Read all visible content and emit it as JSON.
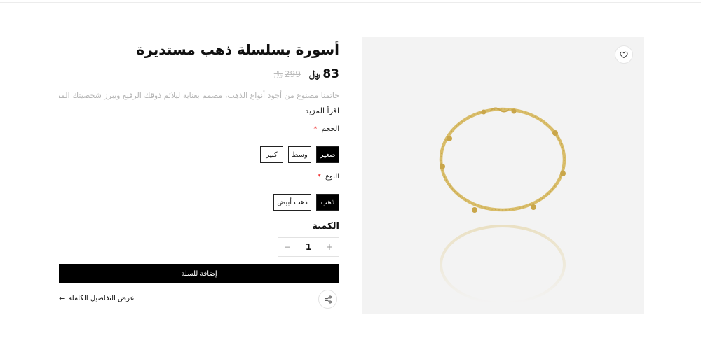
{
  "product": {
    "title": "أسورة بسلسلة ذهب مستديرة",
    "price": "83",
    "old_price": "299",
    "currency_symbol": "﷼",
    "description": "خاتمنا مصنوع من أجود أنواع الذهب، مصمم بعناية ليلائم ذوقك الرفيع ويبرز شخصيتك المميزة...",
    "read_more": "اقرأ المزيد"
  },
  "options": {
    "size": {
      "label": "الحجم",
      "required_mark": "*",
      "values": [
        "صغير",
        "وسط",
        "كبير"
      ],
      "selected": "صغير"
    },
    "type": {
      "label": "النوع",
      "required_mark": "*",
      "values": [
        "ذهب",
        "ذهب أبيض"
      ],
      "selected": "ذهب"
    }
  },
  "quantity": {
    "label": "الكمية",
    "value": "1",
    "increment": "+",
    "decrement": "−"
  },
  "actions": {
    "add_to_cart": "إضافة للسلة",
    "full_details": "عرض التفاصيل الكاملة",
    "share_icon": "share-icon",
    "wishlist_icon": "heart-icon"
  },
  "colors": {
    "gold": "#d9bd6a",
    "gold_dark": "#b8983e",
    "image_bg": "#f3f3f3",
    "required": "#e11111"
  }
}
